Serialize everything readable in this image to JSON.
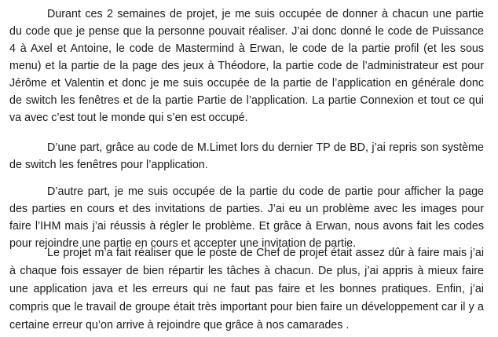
{
  "document": {
    "paragraphs": [
      {
        "lines": [
          "Durant ces 2 semaines de projet, je me suis occupée de donner à chacun une partie",
          "du code que je pense que la personne pouvait réaliser. J’ai donc donné le code de Puissance",
          "4 à Axel et Antoine, le code de Mastermind à Erwan, le code de la partie profil (et les sous",
          "menu) et la partie de la page des jeux à Théodore, la partie code de l’administrateur est pour",
          "Jérôme et Valentin et donc je me suis occupée de la partie de l’application en générale donc",
          "de switch les fenêtres et de la partie Partie de l’application. La partie Connexion et tout ce qui",
          "va avec c’est tout le monde qui s’en est occupé."
        ]
      },
      {
        "lines": [
          "D’une part, grâce au code de M.Limet lors du dernier TP de BD, j’ai repris son système",
          "de switch les fenêtres pour l’application."
        ]
      },
      {
        "lines": [
          "D’autre part, je me suis occupée de la partie du code de partie pour afficher la page",
          "des parties en cours et des invitations de parties. J’ai eu un problème avec les images pour",
          "faire l’IHM mais j’ai réussis à régler le problème. Et grâce à Erwan, nous avons fait les codes",
          "pour rejoindre une partie en cours et accepter une invitation de partie."
        ]
      },
      {
        "lines": [
          "Le projet m’a fait réaliser que le poste de Chef de projet était assez dûr à faire mais j’ai",
          "à chaque fois essayer de bien répartir les tâches à chacun. De plus, j’ai appris à mieux faire",
          "une application java et les erreurs qui ne faut pas faire et les bonnes pratiques. Enfin, j’ai",
          "compris que le travail de groupe était très important pour bien faire un développement car il y a",
          "certaine erreur qu’on arrive à rejoindre que grâce à nos camarades ."
        ]
      }
    ]
  }
}
